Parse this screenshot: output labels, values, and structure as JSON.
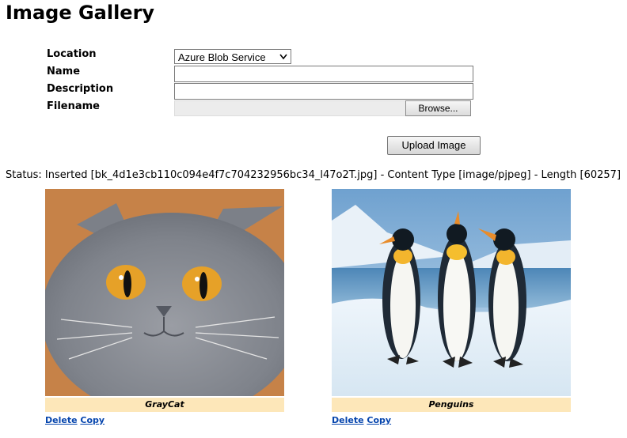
{
  "page": {
    "title": "Image Gallery"
  },
  "form": {
    "location_label": "Location",
    "location_value": "Azure Blob Service",
    "name_label": "Name",
    "name_value": "",
    "description_label": "Description",
    "description_value": "",
    "filename_label": "Filename",
    "browse_label": "Browse...",
    "upload_label": "Upload Image"
  },
  "status": "Status: Inserted [bk_4d1e3cb110c094e4f7c704232956bc34_l47o2T.jpg] - Content Type [image/pjpeg] - Length [60257]",
  "gallery": [
    {
      "caption": "GrayCat",
      "delete_label": "Delete",
      "copy_label": "Copy"
    },
    {
      "caption": "Penguins",
      "delete_label": "Delete",
      "copy_label": "Copy"
    }
  ]
}
